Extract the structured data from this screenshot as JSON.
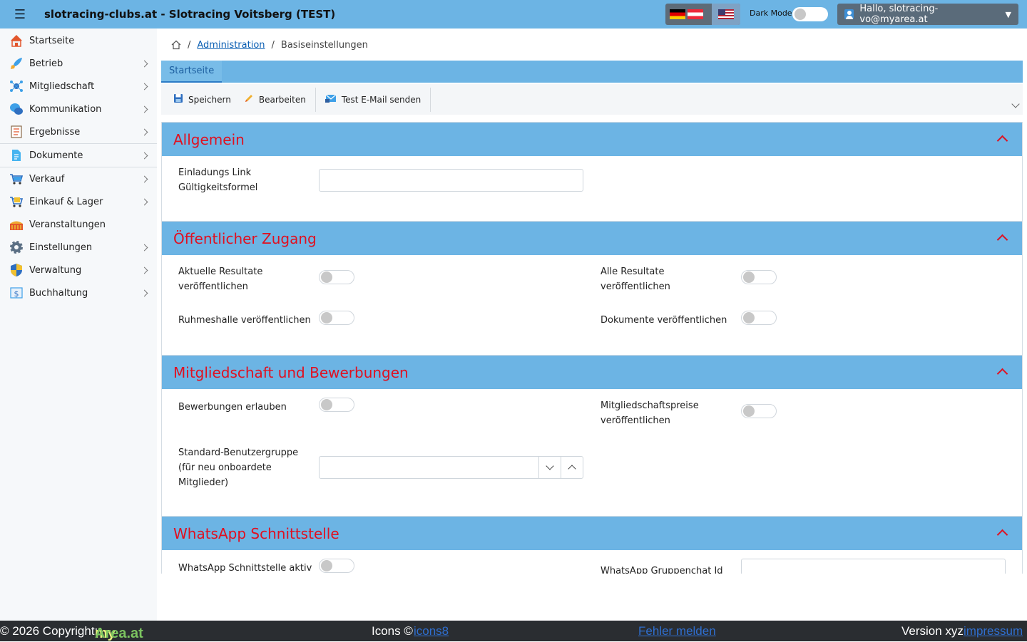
{
  "app": {
    "title": "slotracing-clubs.at - Slotracing Voitsberg (TEST)",
    "dark_mode_label": "Dark Mode",
    "user_greeting": "Hallo, slotracing-vo@myarea.at"
  },
  "sidebar": {
    "items": [
      {
        "label": "Startseite",
        "icon": "home-icon"
      },
      {
        "label": "Betrieb",
        "icon": "rocket-icon"
      },
      {
        "label": "Mitgliedschaft",
        "icon": "network-icon"
      },
      {
        "label": "Kommunikation",
        "icon": "chat-icon"
      },
      {
        "label": "Ergebnisse",
        "icon": "results-icon"
      },
      {
        "label": "Dokumente",
        "icon": "document-icon"
      },
      {
        "label": "Verkauf",
        "icon": "cart-icon"
      },
      {
        "label": "Einkauf & Lager",
        "icon": "warehouse-cart-icon"
      },
      {
        "label": "Veranstaltungen",
        "icon": "event-icon"
      },
      {
        "label": "Einstellungen",
        "icon": "gear-icon"
      },
      {
        "label": "Verwaltung",
        "icon": "shield-icon"
      },
      {
        "label": "Buchhaltung",
        "icon": "accounting-icon"
      }
    ]
  },
  "breadcrumb": {
    "link": "Administration",
    "current": "Basiseinstellungen"
  },
  "tabs": [
    {
      "label": "Startseite"
    }
  ],
  "toolbar": {
    "save": "Speichern",
    "edit": "Bearbeiten",
    "test_mail": "Test E-Mail senden"
  },
  "sections": {
    "allgemein": {
      "title": "Allgemein",
      "invite_label_1": "Einladungs Link",
      "invite_label_2": "Gültigkeitsformel",
      "invite_value": ""
    },
    "public": {
      "title": "Öffentlicher Zugang",
      "current_results_1": "Aktuelle Resultate",
      "current_results_2": "veröffentlichen",
      "all_results_1": "Alle Resultate",
      "all_results_2": "veröffentlichen",
      "hall_of_fame": "Ruhmeshalle veröffentlichen",
      "documents": "Dokumente veröffentlichen"
    },
    "membership": {
      "title": "Mitgliedschaft und Bewerbungen",
      "allow_applications": "Bewerbungen erlauben",
      "prices_1": "Mitgliedschaftspreise",
      "prices_2": "veröffentlichen",
      "group_1": "Standard-Benutzergruppe",
      "group_2": "(für neu onboardete",
      "group_3": "Mitglieder)",
      "group_value": ""
    },
    "whatsapp": {
      "title": "WhatsApp Schnittstelle",
      "active": "WhatsApp Schnittstelle aktiv",
      "group_chat_id": "WhatsApp Gruppenchat Id",
      "group_chat_value": ""
    }
  },
  "footer": {
    "copyright": "© 2026 Copyright:",
    "brand_my": "my",
    "brand_area": "Area.at",
    "icons_prefix": "Icons ©",
    "icons_link": "icons8",
    "report": "Fehler melden",
    "version": "Version xyz",
    "imprint": "impressum"
  },
  "colors": {
    "header": "#6cb4e4",
    "section_title": "#e01020",
    "footer": "#2a2d31"
  }
}
